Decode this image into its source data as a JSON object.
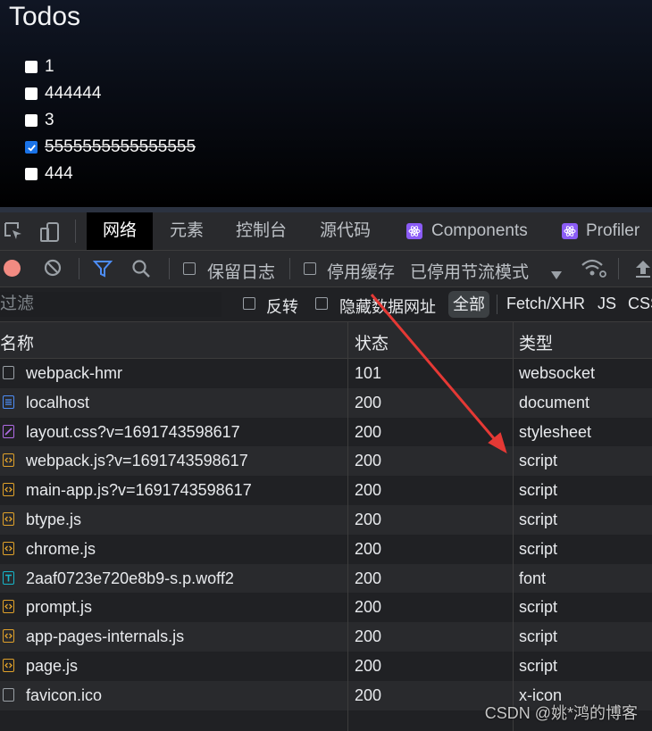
{
  "app": {
    "title": "Todos",
    "todos": [
      {
        "text": "1",
        "checked": false
      },
      {
        "text": "444444",
        "checked": false
      },
      {
        "text": "3",
        "checked": false
      },
      {
        "text": "5555555555555555",
        "checked": true
      },
      {
        "text": "444",
        "checked": false
      }
    ]
  },
  "devtools": {
    "tabs": [
      "网络",
      "元素",
      "控制台",
      "源代码",
      "Components",
      "Profiler"
    ],
    "active_tab": "网络",
    "toolbar": {
      "preserve_log": "保留日志",
      "disable_cache": "停用缓存",
      "throttle": "已停用节流模式"
    },
    "filterbar": {
      "placeholder": "过滤",
      "invert": "反转",
      "hide_data_urls": "隐藏数据网址",
      "all": "全部",
      "fetch_xhr": "Fetch/XHR",
      "js": "JS",
      "css": "CSS"
    },
    "columns": {
      "name": "名称",
      "status": "状态",
      "type": "类型"
    },
    "requests": [
      {
        "name": "webpack-hmr",
        "status": "101",
        "type": "websocket",
        "icon": "blank"
      },
      {
        "name": "localhost",
        "status": "200",
        "type": "document",
        "icon": "doc"
      },
      {
        "name": "layout.css?v=1691743598617",
        "status": "200",
        "type": "stylesheet",
        "icon": "css"
      },
      {
        "name": "webpack.js?v=1691743598617",
        "status": "200",
        "type": "script",
        "icon": "js"
      },
      {
        "name": "main-app.js?v=1691743598617",
        "status": "200",
        "type": "script",
        "icon": "js"
      },
      {
        "name": "btype.js",
        "status": "200",
        "type": "script",
        "icon": "js"
      },
      {
        "name": "chrome.js",
        "status": "200",
        "type": "script",
        "icon": "js"
      },
      {
        "name": "2aaf0723e720e8b9-s.p.woff2",
        "status": "200",
        "type": "font",
        "icon": "font"
      },
      {
        "name": "prompt.js",
        "status": "200",
        "type": "script",
        "icon": "js"
      },
      {
        "name": "app-pages-internals.js",
        "status": "200",
        "type": "script",
        "icon": "js"
      },
      {
        "name": "page.js",
        "status": "200",
        "type": "script",
        "icon": "js"
      },
      {
        "name": "favicon.ico",
        "status": "200",
        "type": "x-icon",
        "icon": "blank"
      }
    ]
  },
  "watermark": "CSDN @姚*鸿的博客",
  "colors": {
    "accent": "#1a73e8",
    "arrow": "#e53935",
    "record": "#f28b82"
  }
}
